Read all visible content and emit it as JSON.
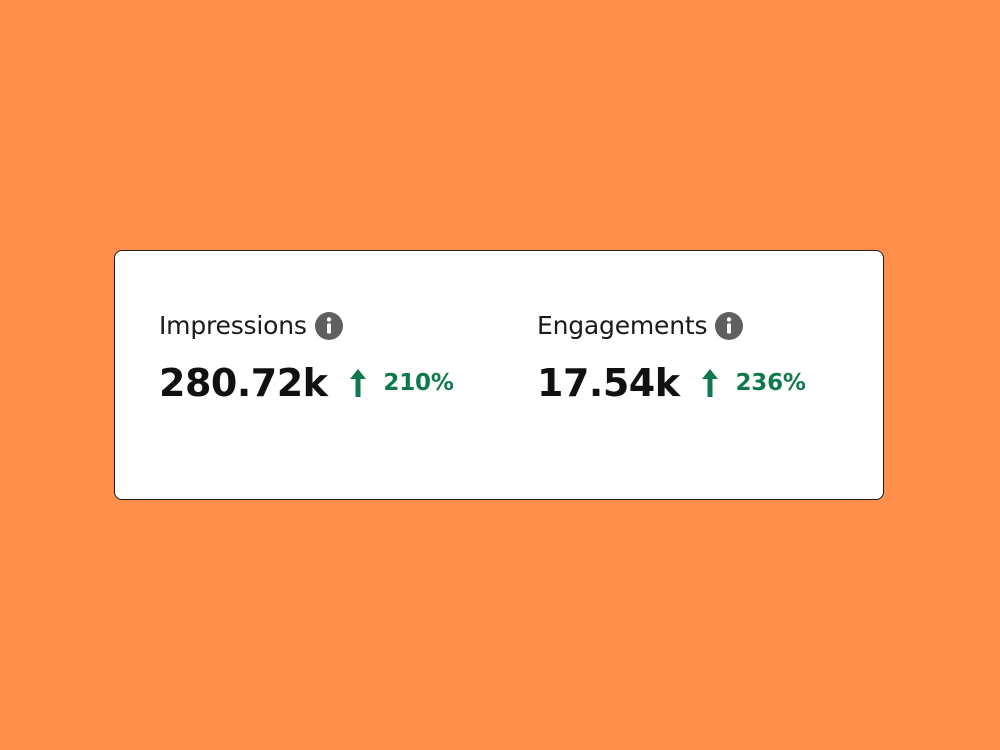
{
  "card": {
    "metrics": [
      {
        "label": "Impressions",
        "info_icon": "info-icon",
        "value": "280.72k",
        "trend_icon": "arrow-up-icon",
        "change": "210%"
      },
      {
        "label": "Engagements",
        "info_icon": "info-icon",
        "value": "17.54k",
        "trend_icon": "arrow-up-icon",
        "change": "236%"
      }
    ]
  },
  "colors": {
    "background": "#ff8f4b",
    "card": "#ffffff",
    "text": "#1a1a1a",
    "info_icon": "#5f5f5f",
    "positive": "#0e7a4b"
  }
}
